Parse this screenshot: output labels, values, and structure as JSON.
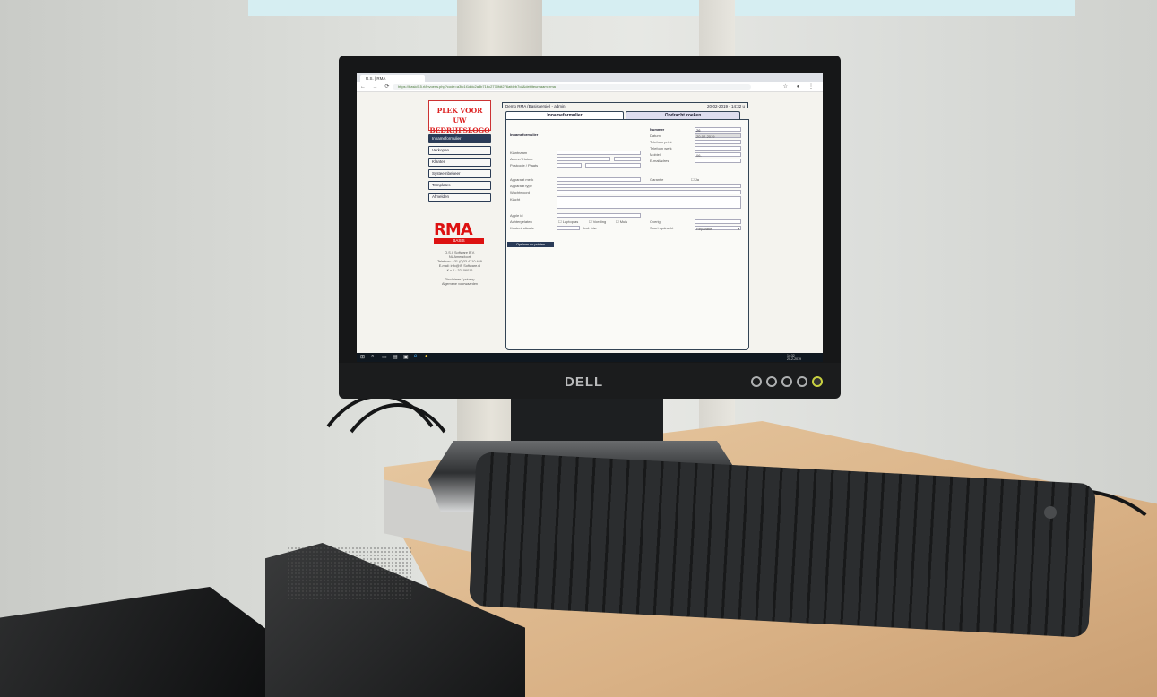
{
  "browser": {
    "tab_title": "R.S. | RMA",
    "url": "https://basic5.5.rl/invoerw.php?code=a3fc1t1ddc2a8b71bc2770fdt276afdeb7c8&debiteurnaam=rma"
  },
  "sidebar": {
    "logo_text_line1": "PLEK VOOR UW",
    "logo_text_line2": "BEDRIJFSLOGO",
    "items": [
      {
        "label": "Innameformulier",
        "active": true
      },
      {
        "label": "Verkopen",
        "active": false
      },
      {
        "label": "Klanten",
        "active": false
      },
      {
        "label": "Systeembeheer",
        "active": false
      },
      {
        "label": "Templates",
        "active": false
      },
      {
        "label": "Afmelden",
        "active": false
      }
    ],
    "brand": "RMA",
    "brand_sub": "BASIS",
    "company_lines": [
      "O.S.I. Software B.V.",
      "NL Amersfoort",
      "Telefoon: +31 (0)33 4710 469",
      "E-mail: info@IS Software.nl",
      "K.v.K.: 32106016",
      "",
      "Disclaimer / privacy",
      "Algemene voorwaarden"
    ]
  },
  "header": {
    "left": "Demo RMA (Basisversie) - admin",
    "right": "20-02-2019 - 14:32 u"
  },
  "tabs": [
    "Innameformulier",
    "Opdracht zoeken"
  ],
  "form": {
    "section_title": "Innameformulier",
    "labels_left": [
      "Klantnaam",
      "Adres / Huisnr.",
      "Postcode / Plaats",
      "Apparaat merk",
      "Apparaat type",
      "Wachtwoord",
      "Klacht",
      "Apple id",
      "Achtergelaten",
      "Kostenindicatie"
    ],
    "labels_right": [
      "Nummer",
      "Datum",
      "Telefoon privé",
      "Telefoon werk",
      "Mobiel",
      "E-mailadres",
      "Garantie",
      "Overig",
      "Soort opdracht"
    ],
    "nummer": "26",
    "datum": "20-02-2019",
    "mobiel": "06-",
    "garantie_opt": "Ja",
    "achtergelaten_opts": [
      "Laptoptas",
      "Voeding",
      "Muis"
    ],
    "kosten_suffix": "Incl. btw",
    "soort_opdracht": "Reparatie",
    "save_button": "Opslaan en printen"
  },
  "monitor_brand": "DELL",
  "taskbar": {
    "time": "14:32",
    "date": "20-2-2019"
  }
}
